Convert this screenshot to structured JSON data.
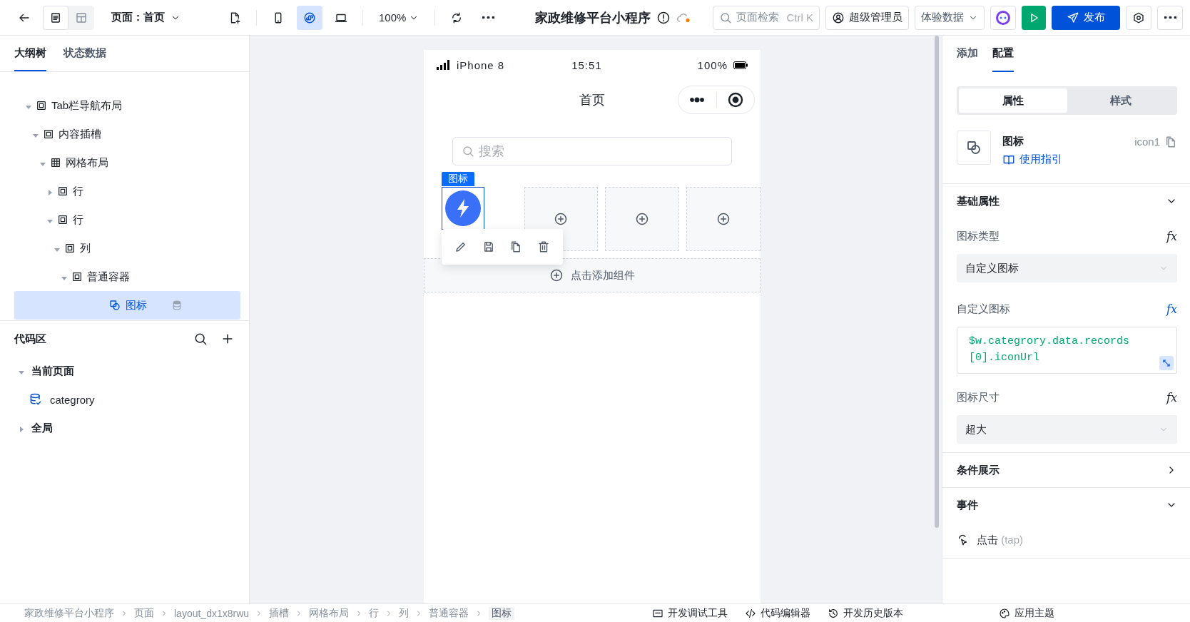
{
  "toolbar": {
    "view_modes": [
      {
        "kind": "outline",
        "selected": true
      },
      {
        "kind": "layout",
        "selected": false
      }
    ],
    "page_selector": "页面：首页",
    "device_modes": [
      {
        "kind": "mobile",
        "selected": false
      },
      {
        "kind": "miniprogram",
        "selected": true
      },
      {
        "kind": "desktop",
        "selected": false
      }
    ],
    "zoom": "100%",
    "app_title": "家政维修平台小程序",
    "search": {
      "placeholder": "页面检索",
      "shortcut": "Ctrl K"
    },
    "user": "超级管理员",
    "data_mode": "体验数据",
    "publish": "发布"
  },
  "left_panel": {
    "tabs": [
      {
        "label": "大纲树",
        "selected": true
      },
      {
        "label": "状态数据",
        "selected": false
      }
    ],
    "tree": [
      {
        "label": "Tab栏导航布局",
        "kind": "container",
        "expanded": true,
        "selected": false,
        "children": [
          {
            "label": "内容插槽",
            "kind": "container",
            "expanded": true,
            "selected": false,
            "children": [
              {
                "label": "网格布局",
                "kind": "grid",
                "expanded": true,
                "selected": false,
                "children": [
                  {
                    "label": "行",
                    "kind": "container",
                    "expanded": false,
                    "selected": false
                  },
                  {
                    "label": "行",
                    "kind": "container",
                    "expanded": true,
                    "selected": false,
                    "children": [
                      {
                        "label": "列",
                        "kind": "container",
                        "expanded": true,
                        "selected": false,
                        "children": [
                          {
                            "label": "普通容器",
                            "kind": "container",
                            "expanded": true,
                            "selected": false,
                            "children": [
                              {
                                "label": "图标",
                                "kind": "icon",
                                "selected": true
                              }
                            ]
                          }
                        ]
                      }
                    ]
                  }
                ]
              }
            ]
          }
        ]
      }
    ],
    "code_area": {
      "title": "代码区",
      "groups": [
        {
          "label": "当前页面",
          "expanded": true,
          "items": [
            "categrory"
          ]
        },
        {
          "label": "全局",
          "expanded": false
        }
      ]
    }
  },
  "phone": {
    "carrier": "iPhone 8",
    "time": "15:51",
    "battery": "100%",
    "nav_title": "首页",
    "search_placeholder": "搜索",
    "selection_tag": "图标",
    "grid_cells": [
      {
        "kind": "icon"
      },
      {
        "kind": "empty"
      },
      {
        "kind": "empty"
      },
      {
        "kind": "empty"
      }
    ],
    "add_component": "点击添加组件"
  },
  "right_panel": {
    "tabs": [
      {
        "label": "添加",
        "selected": false
      },
      {
        "label": "配置",
        "selected": true
      }
    ],
    "sub_tabs": [
      {
        "label": "属性",
        "selected": true
      },
      {
        "label": "样式",
        "selected": false
      }
    ],
    "component": {
      "name": "图标",
      "id": "icon1",
      "guide": "使用指引"
    },
    "sections": [
      {
        "title": "基础属性",
        "expanded": true,
        "fields": [
          {
            "label": "图标类型",
            "kind": "select",
            "value": "自定义图标",
            "formula": "fx",
            "bound": false
          },
          {
            "label": "自定义图标",
            "kind": "code",
            "value": "$w.categrory.data.records[0].iconUrl",
            "formula": "fx",
            "bound": true
          },
          {
            "label": "图标尺寸",
            "kind": "select",
            "value": "超大",
            "formula": "fx",
            "bound": false
          }
        ]
      },
      {
        "title": "条件展示",
        "expanded": false
      },
      {
        "title": "事件",
        "expanded": true,
        "events": [
          {
            "label": "点击",
            "hint": "(tap)"
          }
        ]
      }
    ]
  },
  "breadcrumb": [
    {
      "label": "家政维修平台小程序",
      "selected": false
    },
    {
      "label": "页面",
      "selected": false
    },
    {
      "label": "layout_dx1x8rwu",
      "selected": false
    },
    {
      "label": "插槽",
      "selected": false
    },
    {
      "label": "网格布局",
      "selected": false
    },
    {
      "label": "行",
      "selected": false
    },
    {
      "label": "列",
      "selected": false
    },
    {
      "label": "普通容器",
      "selected": false
    },
    {
      "label": "图标",
      "selected": true
    }
  ],
  "bottom_tools": [
    {
      "kind": "debug",
      "label": "开发调试工具"
    },
    {
      "kind": "code",
      "label": "代码编辑器"
    },
    {
      "kind": "history",
      "label": "开发历史版本"
    },
    {
      "kind": "theme",
      "label": "应用主题"
    }
  ]
}
